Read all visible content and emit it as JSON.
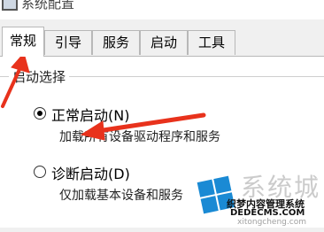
{
  "window": {
    "title": "系统配置"
  },
  "tabs": [
    {
      "label": "常规",
      "active": true
    },
    {
      "label": "引导",
      "active": false
    },
    {
      "label": "服务",
      "active": false
    },
    {
      "label": "启动",
      "active": false
    },
    {
      "label": "工具",
      "active": false
    }
  ],
  "startup": {
    "group_label": "启动选择",
    "options": [
      {
        "label": "正常启动(N)",
        "description": "加载所有设备驱动程序和服务",
        "checked": true
      },
      {
        "label": "诊断启动(D)",
        "description": "仅加载基本设备和服务",
        "checked": false
      }
    ]
  },
  "watermark": {
    "brand": "系统城",
    "line1": "织梦内容管理系统",
    "line2": "DEDECMS.COM",
    "line3": "xitongcheng.com"
  },
  "colors": {
    "annotation_arrow": "#e8321c",
    "logo_blue": "#1a8ad4"
  },
  "icons": [
    "app-icon",
    "annotation-arrow",
    "windows-logo-icon"
  ]
}
